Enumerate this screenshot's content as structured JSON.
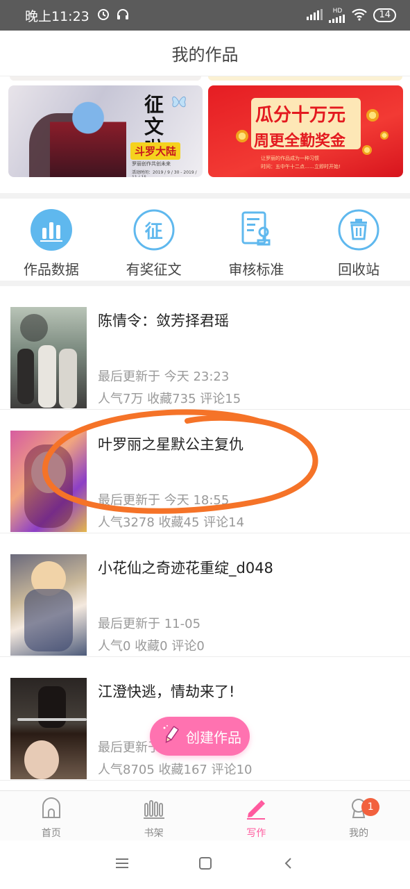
{
  "status_bar": {
    "time": "晚上11:23",
    "network_label": "HD",
    "battery": "14"
  },
  "header": {
    "title": "我的作品"
  },
  "banners": [
    {
      "title": "征文啦",
      "tag": "斗罗大陆",
      "line1": "罗丽创作共创未来",
      "line2": "活动时间：2019 / 9 / 30 - 2019 / 11 / 15"
    },
    {
      "title_line1": "瓜分十万元",
      "title_line2": "周更全勤奖金",
      "sub1": "让罗丽的作品成为一种习惯",
      "sub2": "时间：五中午十二点……立即时开始!"
    }
  ],
  "actions": [
    {
      "label": "作品数据",
      "icon": "bar-chart-icon"
    },
    {
      "label": "有奖征文",
      "icon": "contest-icon",
      "glyph": "征"
    },
    {
      "label": "审核标准",
      "icon": "review-standard-icon"
    },
    {
      "label": "回收站",
      "icon": "trash-icon"
    }
  ],
  "works": [
    {
      "title": "陈情令：敛芳择君瑶",
      "updated": "最后更新于 今天 23:23",
      "stats": "人气7万 收藏735 评论15"
    },
    {
      "title": "叶罗丽之星默公主复仇",
      "updated": "最后更新于 今天 18:55",
      "stats": "人气3278 收藏45 评论14"
    },
    {
      "title": "小花仙之奇迹花重绽_d048",
      "updated": "最后更新于 11-05",
      "stats": "人气0 收藏0 评论0"
    },
    {
      "title": "江澄快逃，情劫来了!",
      "updated": "最后更新于 今天 21:08",
      "stats": "人气8705 收藏167 评论10"
    }
  ],
  "fab": {
    "label": "创建作品"
  },
  "tabs": [
    {
      "label": "首页",
      "icon": "home-icon"
    },
    {
      "label": "书架",
      "icon": "bookshelf-icon"
    },
    {
      "label": "写作",
      "icon": "pen-icon",
      "active": true
    },
    {
      "label": "我的",
      "icon": "profile-icon",
      "badge": "1"
    }
  ],
  "colors": {
    "accent": "#ff72b0",
    "action_icon": "#5fb8ee",
    "annotation": "#f57328",
    "badge": "#f2613e"
  }
}
